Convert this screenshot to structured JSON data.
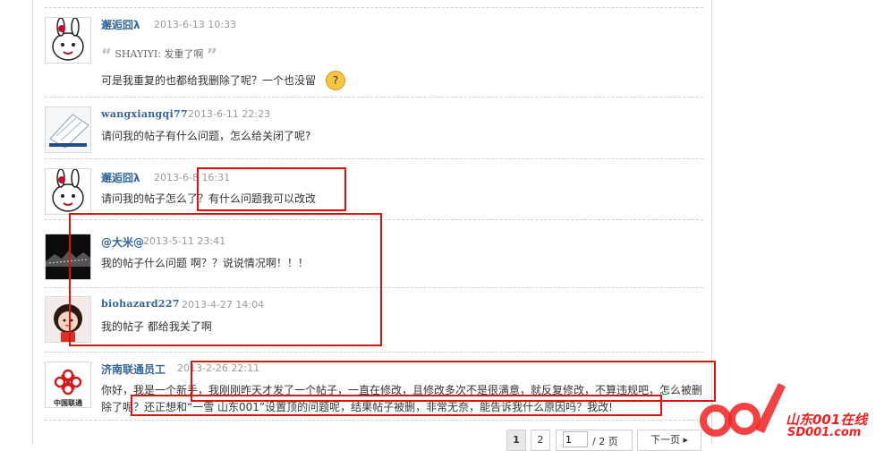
{
  "posts": [
    {
      "name": "邂逅囧λ",
      "time": "2013-6-13 10:33",
      "quote_author": "SHAYIYI",
      "quote_sep": ":",
      "quote_text": "发重了啊",
      "quote_open": "“",
      "quote_close": "”",
      "text": "可是我重复的也都给我删除了呢？一个也没留",
      "avatar": "rabbit-avatar"
    },
    {
      "name": "wangxiangqi77",
      "time": "2013-6-11 22:23",
      "text": "请问我的帖子有什么问题，怎么给关闭了呢?",
      "avatar": "building-avatar"
    },
    {
      "name": "邂逅囧λ",
      "time": "2013-6-8 16:31",
      "text": "请问我的帖子怎么了？有什么问题我可以改改",
      "avatar": "rabbit-avatar"
    },
    {
      "name": "@大米@",
      "time": "2013-5-11 23:41",
      "text": "我的帖子什么问题 啊？？说说情况啊！！！",
      "avatar": "dark-landscape-avatar"
    },
    {
      "name": "biohazard227",
      "time": "2013-4-27 14:04",
      "text": "我的帖子 都给我关了啊",
      "avatar": "cartoon-girl-avatar"
    },
    {
      "name": "济南联通员工",
      "time": "2013-2-26 22:11",
      "text_line1": "你好，我是一个新手，我刚刚昨天才发了一个帖子，一直在修改，且修改多次不是很满意，就反复修改，不算违规吧，怎么被删",
      "text_line2": "除了呢？还正想和“一雪  山东001”设置顶的问题呢，结果帖子被删，非常无奈，能告诉我什么原因吗？我改!",
      "avatar": "china-unicom-logo",
      "logo_text": "中国联通"
    }
  ],
  "pager": {
    "page1": "1",
    "page2": "2",
    "input_value": "1",
    "total": "/ 2 页",
    "next": "下一页 ▸"
  },
  "watermark": {
    "brand_cn": "山东001在线",
    "brand_url": "SD001.com"
  },
  "colors": {
    "name_link": "#336699",
    "annotation_red": "#e01010",
    "watermark_red": "#e22222"
  }
}
